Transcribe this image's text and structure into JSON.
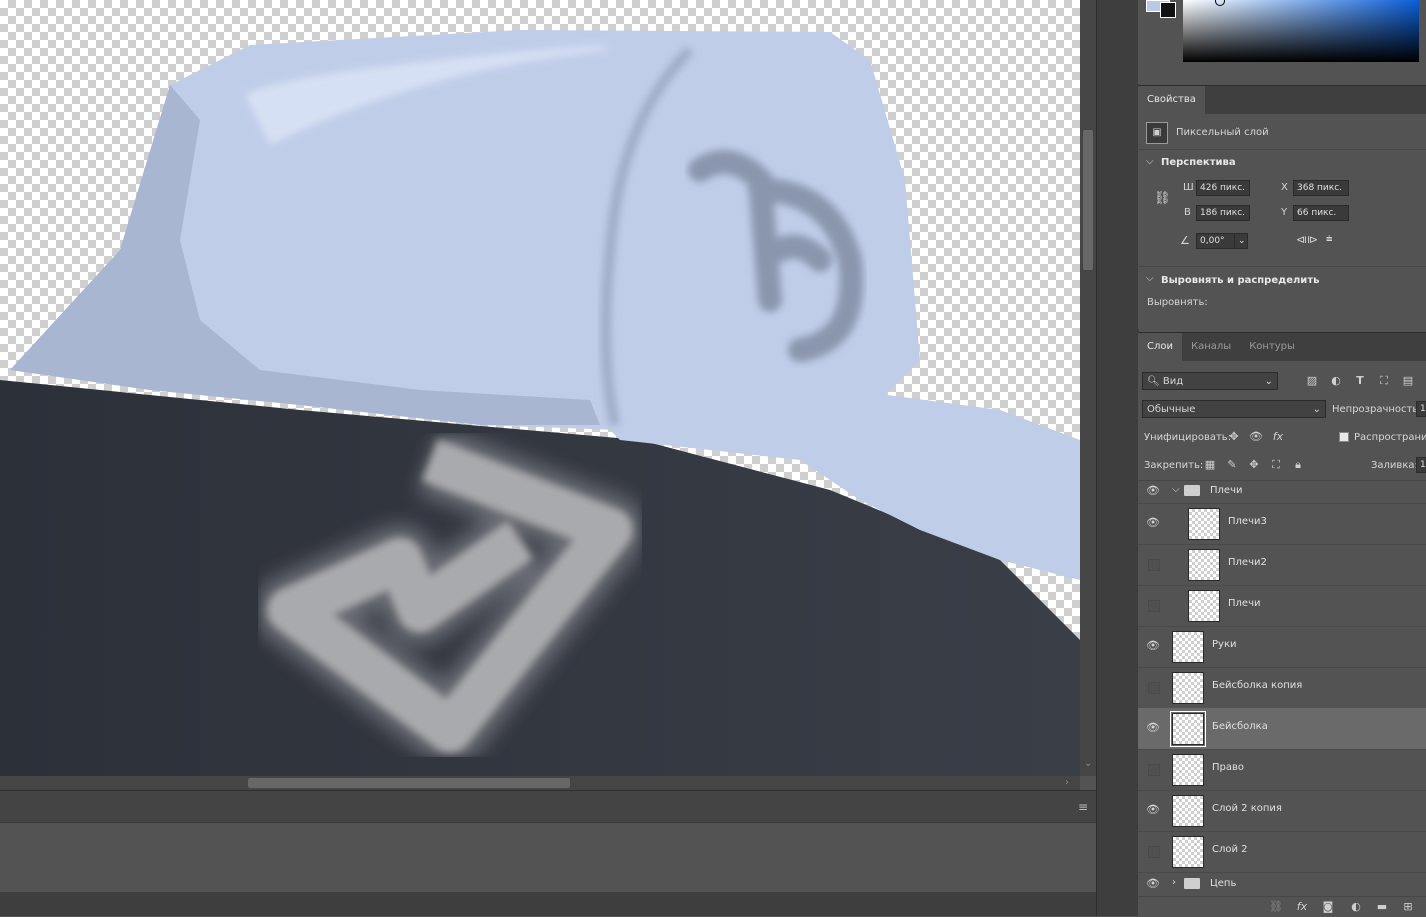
{
  "properties": {
    "tab_label": "Свойства",
    "layer_kind": "Пиксельный слой",
    "perspective_label": "Перспектива",
    "w_label": "Ш",
    "w_value": "426 пикс.",
    "h_label": "В",
    "h_value": "186 пикс.",
    "x_label": "X",
    "x_value": "368 пикс.",
    "y_label": "Y",
    "y_value": "66 пикс.",
    "angle_value": "0,00°",
    "align_section_label": "Выровнять и распределить",
    "align_label": "Выровнять:"
  },
  "layers_panel": {
    "tabs": [
      {
        "label": "Слои",
        "active": true
      },
      {
        "label": "Каналы",
        "active": false
      },
      {
        "label": "Контуры",
        "active": false
      }
    ],
    "filter_label": "Вид",
    "blend_mode": "Обычные",
    "opacity_label": "Непрозрачность:",
    "opacity_value": "1",
    "unify_label": "Унифицировать:",
    "propagate_label": "Распространит",
    "lock_label": "Закрепить:",
    "fill_label": "Заливка:",
    "fill_value": "1",
    "layers": [
      {
        "name": "Плечи",
        "type": "group",
        "visible": true,
        "expanded": true,
        "indent": 0
      },
      {
        "name": "Плечи3",
        "type": "pixel",
        "visible": true,
        "indent": 1
      },
      {
        "name": "Плечи2",
        "type": "pixel",
        "visible": false,
        "indent": 1
      },
      {
        "name": "Плечи",
        "type": "pixel",
        "visible": false,
        "indent": 1
      },
      {
        "name": "Руки",
        "type": "pixel",
        "visible": true,
        "indent": 0
      },
      {
        "name": "Бейсболка копия",
        "type": "pixel",
        "visible": false,
        "indent": 0
      },
      {
        "name": "Бейсболка",
        "type": "pixel",
        "visible": true,
        "indent": 0,
        "selected": true
      },
      {
        "name": "Право",
        "type": "pixel",
        "visible": false,
        "indent": 0
      },
      {
        "name": "Слой 2 копия",
        "type": "pixel",
        "visible": true,
        "indent": 0
      },
      {
        "name": "Слой 2",
        "type": "pixel",
        "visible": false,
        "indent": 0
      },
      {
        "name": "Цепь",
        "type": "group",
        "visible": true,
        "expanded": false,
        "indent": 0
      }
    ]
  },
  "colors": {
    "foreground": "#bcc9e6",
    "panel_bg": "#535353",
    "selected_layer": "#6a6a6a"
  }
}
